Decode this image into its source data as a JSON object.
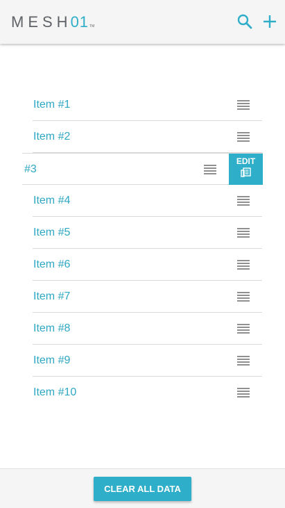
{
  "header": {
    "logo_word": "MESH",
    "logo_number": "01",
    "logo_tm": "TM",
    "icons": [
      "search-icon",
      "plus-icon"
    ]
  },
  "list": {
    "items": [
      {
        "label": "Item #1"
      },
      {
        "label": "Item #2"
      },
      {
        "label": "#3",
        "swiped": true,
        "action_label": "EDIT",
        "action_icon": "edit-icon"
      },
      {
        "label": "Item #4"
      },
      {
        "label": "Item #5"
      },
      {
        "label": "Item #6"
      },
      {
        "label": "Item #7"
      },
      {
        "label": "Item #8"
      },
      {
        "label": "Item #9"
      },
      {
        "label": "Item #10"
      }
    ]
  },
  "footer": {
    "clear_label": "CLEAR ALL DATA"
  },
  "colors": {
    "accent": "#2eaec8",
    "header_bg": "#f5f5f5",
    "logo_gray": "#5f6266",
    "divider": "#d9d9d9"
  }
}
